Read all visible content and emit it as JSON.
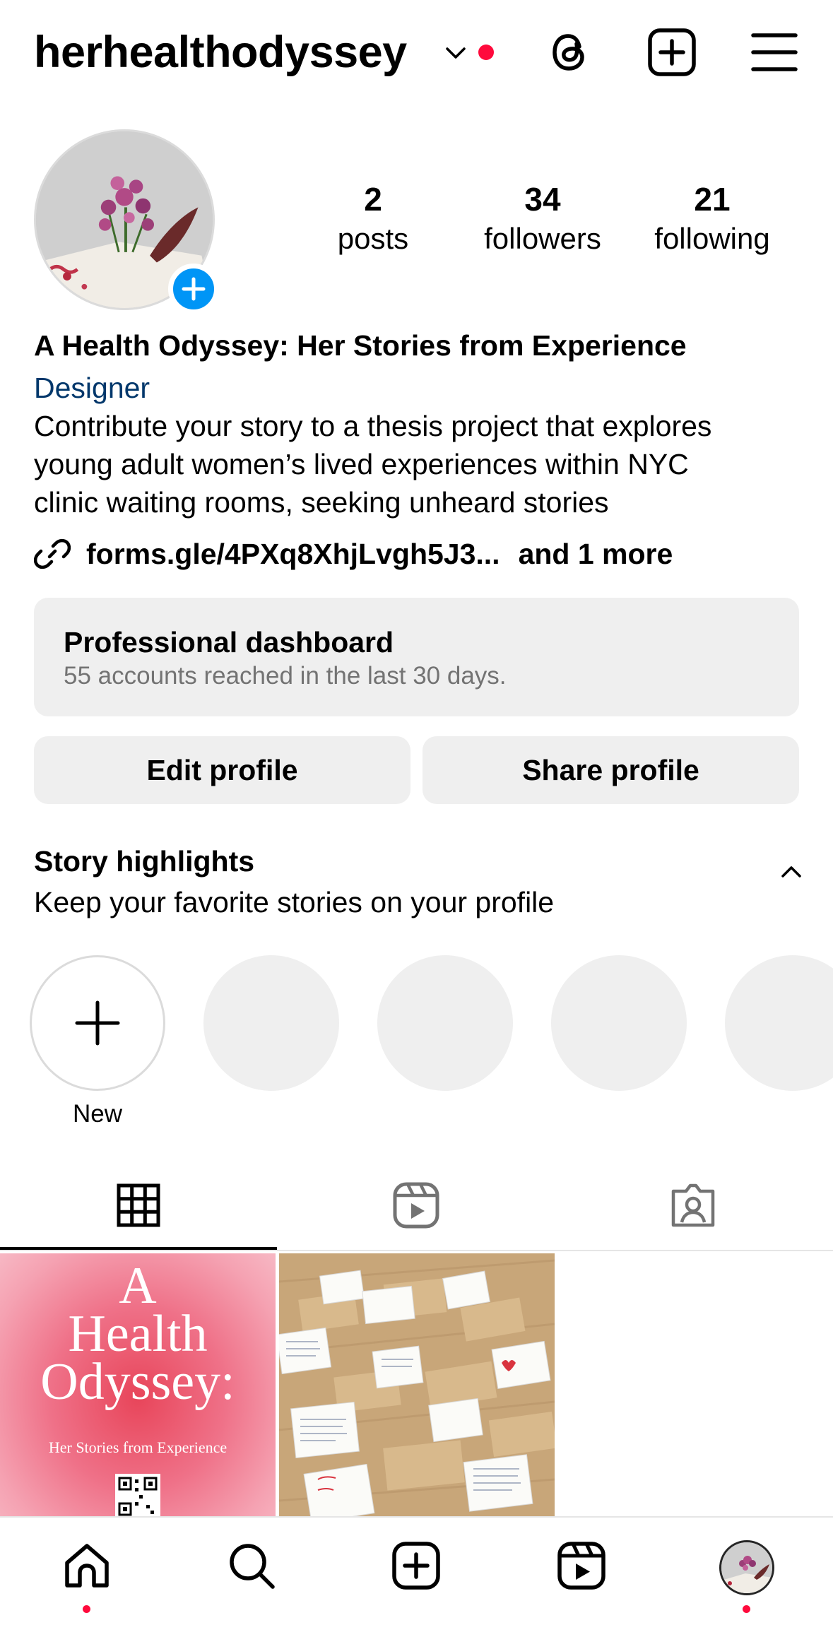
{
  "header": {
    "username": "herhealthodyssey",
    "icons": [
      "chevron-down-icon",
      "notification-dot",
      "threads-icon",
      "create-icon",
      "menu-icon"
    ]
  },
  "profile": {
    "stats": [
      {
        "value": "2",
        "label": "posts"
      },
      {
        "value": "34",
        "label": "followers"
      },
      {
        "value": "21",
        "label": "following"
      }
    ],
    "full_name": "A Health Odyssey: Her Stories from Experience",
    "category": "Designer",
    "bio_lines": [
      "Contribute your story to a thesis project that explores",
      "young adult women’s lived experiences within NYC",
      "clinic waiting rooms, seeking unheard stories"
    ],
    "link": "forms.gle/4PXq8XhjLvgh5J3...",
    "link_more": "and 1 more"
  },
  "dashboard": {
    "title": "Professional dashboard",
    "subtitle": "55 accounts reached in the last 30 days."
  },
  "buttons": {
    "edit": "Edit profile",
    "share": "Share profile"
  },
  "highlights": {
    "title": "Story highlights",
    "subtitle": "Keep your favorite stories on your profile",
    "new_label": "New"
  },
  "posts": {
    "post1_title_lines": [
      "A",
      "Health",
      "Odyssey:"
    ],
    "post1_subtitle": "Her Stories from Experience"
  },
  "colors": {
    "accent_blue": "#0095f6",
    "link_blue": "#00376b",
    "notification_red": "#ff0a3c",
    "button_grey": "#efefef"
  }
}
